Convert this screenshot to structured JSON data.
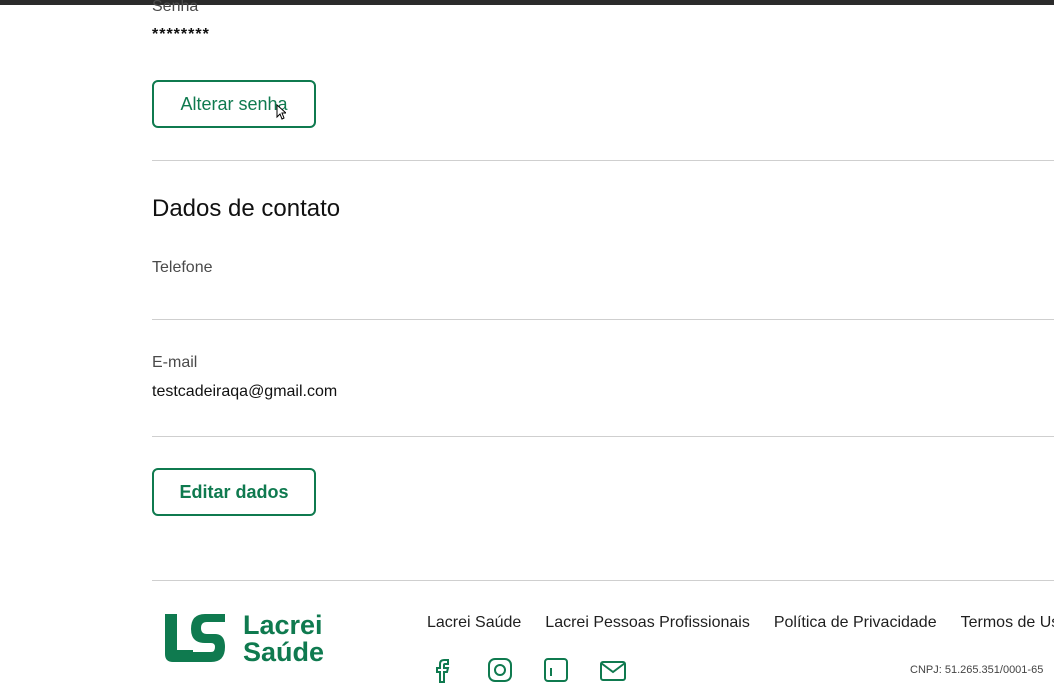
{
  "account": {
    "password_label": "Senha",
    "password_value": "********",
    "change_password_button": "Alterar senha"
  },
  "contact": {
    "section_title": "Dados de contato",
    "phone_label": "Telefone",
    "phone_value": "",
    "email_label": "E-mail",
    "email_value": "testcadeiraqa@gmail.com",
    "edit_button": "Editar dados"
  },
  "footer": {
    "logo_line1": "Lacrei",
    "logo_line2": "Saúde",
    "links": [
      "Lacrei Saúde",
      "Lacrei Pessoas Profissionais",
      "Política de Privacidade",
      "Termos de Uso"
    ],
    "social_icons": [
      "facebook-icon",
      "instagram-icon",
      "linkedin-icon",
      "email-icon"
    ],
    "cnpj_text": "CNPJ: 51.265.351/0001-65"
  },
  "colors": {
    "brand_green": "#0f7a4f",
    "divider": "#cfcfcf"
  }
}
